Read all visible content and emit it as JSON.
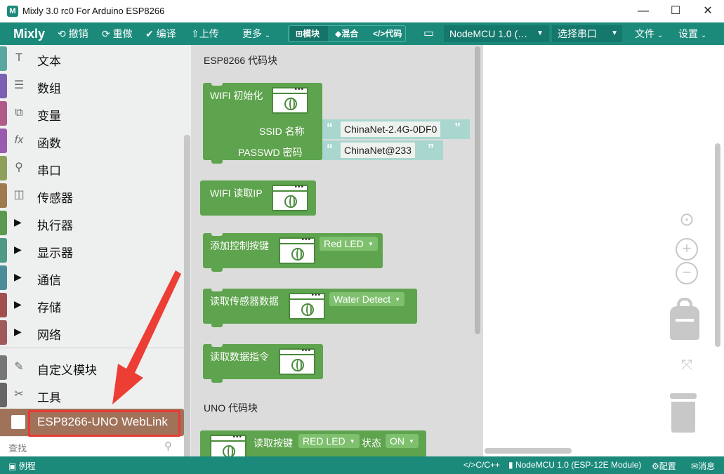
{
  "window": {
    "title": "Mixly 3.0 rc0 For Arduino ESP8266",
    "logo": "M",
    "controls": {
      "minimize": "—",
      "maximize": "☐",
      "close": "✕"
    }
  },
  "toolbar": {
    "brand": "Mixly",
    "undo": "撤销",
    "redo": "重做",
    "compile": "编译",
    "upload": "上传",
    "more": "更多",
    "modes": {
      "blocks": "模块",
      "mixed": "混合",
      "code": "代码"
    },
    "board": "NodeMCU 1.0 (…",
    "port": "选择串口",
    "file": "文件",
    "settings": "设置"
  },
  "sidebar": {
    "categories": [
      {
        "label": "文本",
        "color": "#5aa6a0"
      },
      {
        "label": "数组",
        "color": "#7b5fb0"
      },
      {
        "label": "变量",
        "color": "#b05a8a"
      },
      {
        "label": "函数",
        "color": "#9a5ab0"
      },
      {
        "label": "串口",
        "color": "#8fa05a"
      },
      {
        "label": "传感器",
        "color": "#a07a4e"
      },
      {
        "label": "执行器",
        "color": "#5a9a4e"
      },
      {
        "label": "显示器",
        "color": "#4e9a84"
      },
      {
        "label": "通信",
        "color": "#4e8c9a"
      },
      {
        "label": "存储",
        "color": "#a04e4e"
      },
      {
        "label": "网络",
        "color": "#a05a5a"
      },
      {
        "label": "自定义模块",
        "color": "#777777"
      },
      {
        "label": "工具",
        "color": "#666666"
      }
    ],
    "selected": "ESP8266-UNO WebLink",
    "search_placeholder": "查找"
  },
  "flyout": {
    "heading1": "ESP8266 代码块",
    "heading2": "UNO 代码块",
    "wifi_init": {
      "label": "WIFI 初始化",
      "ssid_label": "SSID  名称",
      "ssid_value": "ChinaNet-2.4G-0DF0",
      "pass_label": "PASSWD  密码",
      "pass_value": "ChinaNet@233"
    },
    "wifi_read_ip": "WIFI 读取IP",
    "add_button": {
      "label": "添加控制按键",
      "value": "Red LED"
    },
    "read_sensor": {
      "label": "读取传感器数据",
      "value": "Water Detect"
    },
    "read_cmd": "读取数据指令",
    "read_key": {
      "label": "读取按键",
      "value": "RED LED",
      "state_label": "状态",
      "state_value": "ON"
    }
  },
  "statusbar": {
    "examples": "例程",
    "lang": "C/C++",
    "board": "NodeMCU 1.0 (ESP-12E Module)",
    "config": "配置",
    "messages": "消息"
  },
  "colors": {
    "accent": "#1b8a7b",
    "block": "#5ea34d",
    "highlight": "#e83a34",
    "weblink": "#a0725a"
  }
}
